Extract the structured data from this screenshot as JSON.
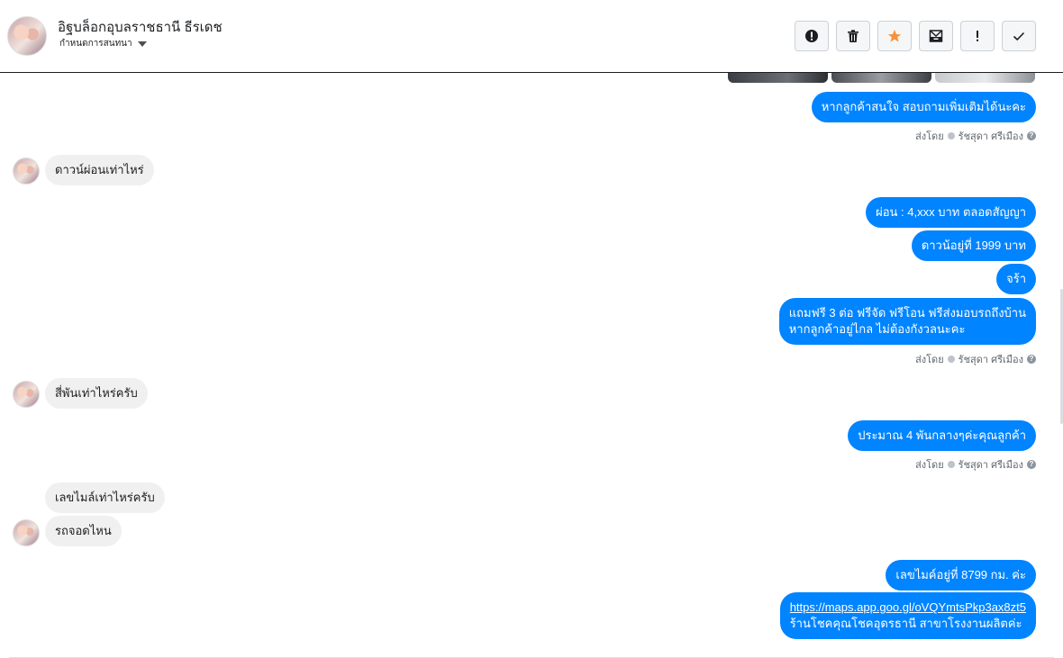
{
  "header": {
    "name": "อิฐบล็อกอุบลราชธานี ธีรเดช",
    "subtitle": "กำหนดการสนทนา",
    "actions": [
      {
        "icon": "alert-circle-icon",
        "name": "report-button"
      },
      {
        "icon": "trash-icon",
        "name": "delete-button"
      },
      {
        "icon": "star-icon",
        "name": "star-button"
      },
      {
        "icon": "archive-icon",
        "name": "archive-button"
      },
      {
        "icon": "exclamation-icon",
        "name": "mark-spam-button"
      },
      {
        "icon": "check-icon",
        "name": "mark-done-button"
      }
    ],
    "star_color": "#f7923b"
  },
  "messages": {
    "m1": "หากลูกค้าสนใจ สอบถามเพิ่มเติมได้นะคะ",
    "m2": "ดาวน์ผ่อนเท่าไหร่",
    "m3": "ผ่อน : 4,xxx บาท ตลอดสัญญา",
    "m4": "ดาวน้อยู่ที่ 1999 บาท",
    "m5": "จร้า",
    "m6_line1": "แถมฟรี 3 ต่อ ฟรีจัด ฟรีโอน  ฟรีส่งมอบรถถึงบ้าน",
    "m6_line2": "หากลูกค้าอยู่ไกล ไม่ต้องกังวลนะคะ",
    "m7": "สี่พันเท่าไหร่ครับ",
    "m8": "ประมาณ 4 พันกลางๆค่ะคุณลูกค้า",
    "m9": "เลขไมล์เท่าไหร่ครับ",
    "m10": "รถจอดไหน",
    "m11": "เลขไมค์อยู่ที่ 8799 กม. ค่ะ",
    "m12_link": "https://maps.app.goo.gl/oVQYmtsPkp3ax8zt5",
    "m12_line2": "ร้านโชคคุณโชคอุดรธานี สาขาโรงงานผลิตค่ะ"
  },
  "sent_by": {
    "label": "ส่งโดย",
    "agent": "รัชสุดา ศรีเมือง"
  },
  "colors": {
    "outgoing_bubble": "#0084ff",
    "incoming_bubble": "#f1f0f0"
  }
}
